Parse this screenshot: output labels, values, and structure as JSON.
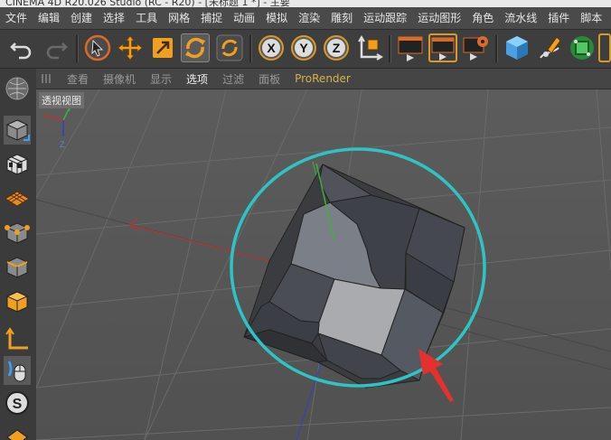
{
  "title": "CINEMA 4D R20.026 Studio (RC - R20) - [未标题 1 *] - 主要",
  "menu": [
    "文件",
    "编辑",
    "创建",
    "选择",
    "工具",
    "网格",
    "捕捉",
    "动画",
    "模拟",
    "渲染",
    "雕刻",
    "运动跟踪",
    "运动图形",
    "角色",
    "流水线",
    "插件",
    "脚本"
  ],
  "viewport_menu": {
    "items": [
      "查看",
      "摄像机",
      "显示",
      "选项",
      "过滤",
      "面板"
    ],
    "active": "选项",
    "prorender": "ProRender"
  },
  "viewport": {
    "label": "透视视图",
    "axis": {
      "x": "X",
      "y": "Y",
      "z": "Z"
    }
  },
  "colors": {
    "highlight_circle": "#2ec4c4",
    "arrow": "#e53030",
    "x_axis": "#c43030",
    "y_axis": "#3fb03f",
    "z_axis": "#3040c8",
    "active_tool_border": "#d89a2a"
  },
  "icons": {
    "toolbar": [
      "undo-icon",
      "redo-icon",
      "select-icon",
      "move-icon",
      "scale-icon",
      "rotate-icon",
      "recent-tool-icon",
      "x-axis-lock-icon",
      "y-axis-lock-icon",
      "z-axis-lock-icon",
      "world-coordinates-icon",
      "render-view-icon",
      "render-to-picture-viewer-icon",
      "render-settings-icon",
      "cube-icon",
      "pen-icon",
      "subdivision-icon"
    ],
    "left": [
      "viewport-solo-icon",
      "model-mode-icon",
      "texture-mode-icon",
      "workplane-icon",
      "points-mode-icon",
      "edges-mode-icon",
      "polygons-mode-icon",
      "axis-mode-icon",
      "tweak-mode-icon",
      "snap-icon"
    ]
  }
}
